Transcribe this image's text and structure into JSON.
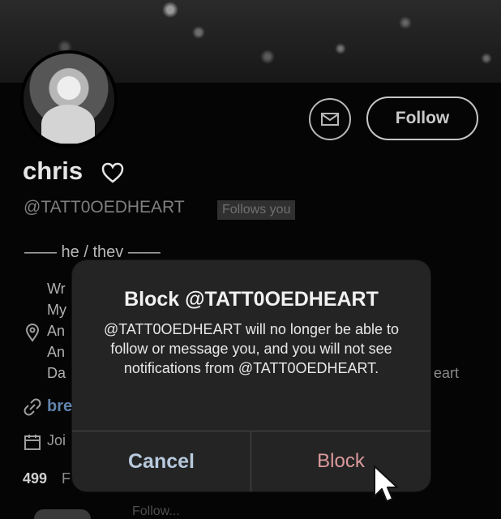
{
  "profile": {
    "display_name": "chris",
    "handle": "@TATT0OEDHEART",
    "follows_you_label": "Follows you",
    "bio_title": "—— he / thev ——",
    "bio_fragments": [
      "Wr",
      "My",
      "An",
      "An",
      "Da"
    ],
    "bio_right_fragment": "eart",
    "link_fragment": "bre",
    "joined_fragment": "Joi",
    "following_count": "499",
    "following_fragment": "F",
    "bottom_fragment": "Follow...",
    "icons": [
      "heart-icon",
      "mail-icon",
      "location-icon",
      "link-icon",
      "calendar-icon"
    ]
  },
  "actions": {
    "follow_label": "Follow",
    "message_icon": "mail-icon"
  },
  "dialog": {
    "title": "Block @TATT0OEDHEART",
    "message": "@TATT0OEDHEART will no longer be able to follow or message you, and you will not see notifications from @TATT0OEDHEART.",
    "cancel_label": "Cancel",
    "block_label": "Block"
  },
  "colors": {
    "background": "#050505",
    "dialog": "#252525",
    "cancel": "#b7c9dd",
    "block": "#dc9a9c",
    "link": "#5f84ad"
  }
}
